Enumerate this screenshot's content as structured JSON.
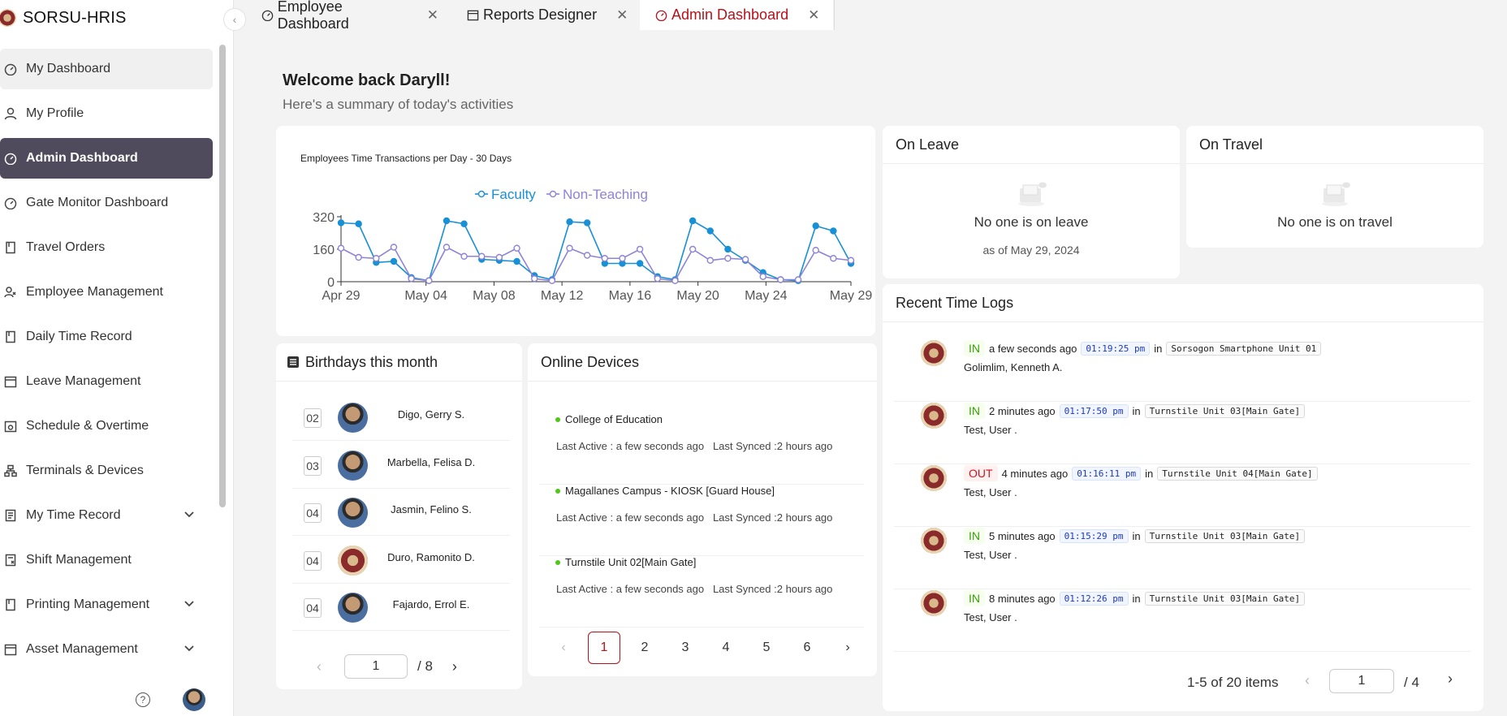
{
  "app": {
    "name": "SORSU-HRIS"
  },
  "sidebar": {
    "items": [
      {
        "label": "My Dashboard",
        "icon": "dashboard-icon"
      },
      {
        "label": "My Profile",
        "icon": "user-icon"
      },
      {
        "label": "Admin Dashboard",
        "icon": "dashboard-icon"
      },
      {
        "label": "Gate Monitor Dashboard",
        "icon": "dashboard-icon"
      },
      {
        "label": "Travel Orders",
        "icon": "book-icon"
      },
      {
        "label": "Employee Management",
        "icon": "users-icon"
      },
      {
        "label": "Daily Time Record",
        "icon": "book-icon"
      },
      {
        "label": "Leave Management",
        "icon": "calendar-icon"
      },
      {
        "label": "Schedule & Overtime",
        "icon": "schedule-icon"
      },
      {
        "label": "Terminals & Devices",
        "icon": "cluster-icon"
      },
      {
        "label": "My Time Record",
        "icon": "record-icon"
      },
      {
        "label": "Shift Management",
        "icon": "shift-icon"
      },
      {
        "label": "Printing Management",
        "icon": "book-icon"
      },
      {
        "label": "Asset Management",
        "icon": "calendar-icon"
      }
    ]
  },
  "tabs": [
    {
      "label": "Employee Dashboard",
      "icon": "dashboard-icon"
    },
    {
      "label": "Reports Designer",
      "icon": "calendar-icon"
    },
    {
      "label": "Admin Dashboard",
      "icon": "dashboard-icon"
    }
  ],
  "welcome": {
    "title": "Welcome back Daryll!",
    "subtitle": "Here's a summary of today's activities"
  },
  "chart_data": {
    "type": "line",
    "title": "Employees Time Transactions per Day - 30 Days",
    "xlabel": "",
    "ylabel": "",
    "ylim": [
      0,
      320
    ],
    "yticks": [
      "0",
      "160",
      "320"
    ],
    "xticks": [
      "Apr 29",
      "May 04",
      "May 08",
      "May 12",
      "May 16",
      "May 20",
      "May 24",
      "May 29"
    ],
    "legend_position": "top-center",
    "series": [
      {
        "name": "Faculty",
        "color": "#1890d5",
        "values": [
          290,
          285,
          95,
          100,
          20,
          5,
          300,
          285,
          110,
          105,
          100,
          30,
          10,
          295,
          290,
          90,
          90,
          90,
          25,
          10,
          300,
          250,
          160,
          105,
          45,
          10,
          5,
          275,
          250,
          90
        ]
      },
      {
        "name": "Non-Teaching",
        "color": "#8e83d6",
        "values": [
          165,
          120,
          115,
          170,
          15,
          5,
          170,
          125,
          125,
          120,
          165,
          15,
          5,
          165,
          130,
          115,
          115,
          160,
          15,
          5,
          160,
          105,
          115,
          110,
          25,
          10,
          10,
          155,
          115,
          105
        ]
      }
    ]
  },
  "on_leave": {
    "title": "On Leave",
    "message": "No one is on leave",
    "sub": "as of May 29, 2024"
  },
  "on_travel": {
    "title": "On Travel",
    "message": "No one is on travel"
  },
  "logs": {
    "title": "Recent Time Logs",
    "rows": [
      {
        "type": "IN",
        "ago": "a few seconds ago",
        "time": "01:19:25 pm",
        "device": "Sorsogon Smartphone Unit 01",
        "name": "Golimlim, Kenneth A."
      },
      {
        "type": "IN",
        "ago": "2 minutes ago",
        "time": "01:17:50 pm",
        "device": "Turnstile Unit 03[Main Gate]",
        "name": "Test, User ."
      },
      {
        "type": "OUT",
        "ago": "4 minutes ago",
        "time": "01:16:11 pm",
        "device": "Turnstile Unit 04[Main Gate]",
        "name": "Test, User ."
      },
      {
        "type": "IN",
        "ago": "5 minutes ago",
        "time": "01:15:29 pm",
        "device": "Turnstile Unit 03[Main Gate]",
        "name": "Test, User ."
      },
      {
        "type": "IN",
        "ago": "8 minutes ago",
        "time": "01:12:26 pm",
        "device": "Turnstile Unit 03[Main Gate]",
        "name": "Test, User ."
      }
    ],
    "in_word": "in",
    "summary": "1-5 of 20 items",
    "page": "1",
    "pages": "/ 4"
  },
  "birthdays": {
    "title": "Birthdays this month",
    "rows": [
      {
        "day": "02",
        "name": "Digo, Gerry S.",
        "avatar": "photo"
      },
      {
        "day": "03",
        "name": "Marbella, Felisa D.",
        "avatar": "photo"
      },
      {
        "day": "04",
        "name": "Jasmin, Felino S.",
        "avatar": "photo"
      },
      {
        "day": "04",
        "name": "Duro, Ramonito D.",
        "avatar": "seal"
      },
      {
        "day": "04",
        "name": "Fajardo, Errol E.",
        "avatar": "photo"
      }
    ],
    "page": "1",
    "pages": "/  8"
  },
  "devices": {
    "title": "Online Devices",
    "rows": [
      {
        "name": "College of Education",
        "active": "Last Active : a few seconds ago",
        "synced": "Last Synced :2 hours ago"
      },
      {
        "name": "Magallanes Campus - KIOSK [Guard House]",
        "active": "Last Active : a few seconds ago",
        "synced": "Last Synced :2 hours ago"
      },
      {
        "name": "Turnstile Unit 02[Main Gate]",
        "active": "Last Active : a few seconds ago",
        "synced": "Last Synced :2 hours ago"
      }
    ],
    "pages": [
      "1",
      "2",
      "3",
      "4",
      "5",
      "6"
    ],
    "current_page": "1"
  },
  "colors": {
    "accent": "#b5121b",
    "active_menu": "#4f4a5c",
    "faculty": "#1890d5",
    "non_teaching": "#8e83d6",
    "online": "#52c41a"
  }
}
